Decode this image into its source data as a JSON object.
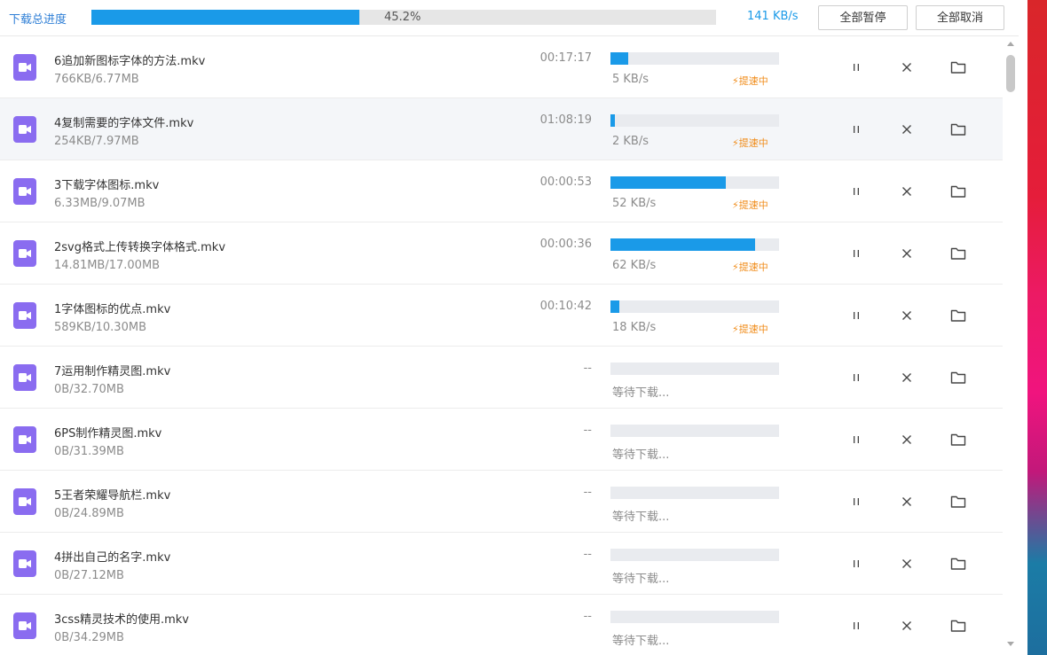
{
  "topbar": {
    "label": "下载总进度",
    "progress_percent": 45.2,
    "progress_text": "45.2%",
    "speed": "141 KB/s",
    "pause_all": "全部暂停",
    "cancel_all": "全部取消"
  },
  "colors": {
    "accent": "#1a9ae8",
    "boost": "#f08c1a",
    "file_icon": "#8a6cf0"
  },
  "icons": {
    "file": "video-file-icon",
    "pause": "pause-icon",
    "close": "close-icon",
    "folder": "folder-icon",
    "boost": "lightning-icon"
  },
  "downloads": [
    {
      "name": "6追加新图标字体的方法.mkv",
      "size": "766KB/6.77MB",
      "time": "00:17:17",
      "progress": 0.105,
      "speed": "5 KB/s",
      "boost": "提速中"
    },
    {
      "name": "4复制需要的字体文件.mkv",
      "size": "254KB/7.97MB",
      "time": "01:08:19",
      "progress": 0.025,
      "speed": "2 KB/s",
      "boost": "提速中"
    },
    {
      "name": "3下载字体图标.mkv",
      "size": "6.33MB/9.07MB",
      "time": "00:00:53",
      "progress": 0.685,
      "speed": "52 KB/s",
      "boost": "提速中"
    },
    {
      "name": "2svg格式上传转换字体格式.mkv",
      "size": "14.81MB/17.00MB",
      "time": "00:00:36",
      "progress": 0.86,
      "speed": "62 KB/s",
      "boost": "提速中"
    },
    {
      "name": "1字体图标的优点.mkv",
      "size": "589KB/10.30MB",
      "time": "00:10:42",
      "progress": 0.055,
      "speed": "18 KB/s",
      "boost": "提速中"
    },
    {
      "name": "7运用制作精灵图.mkv",
      "size": "0B/32.70MB",
      "time": "--",
      "progress": 0,
      "speed": "等待下载...",
      "boost": ""
    },
    {
      "name": "6PS制作精灵图.mkv",
      "size": "0B/31.39MB",
      "time": "--",
      "progress": 0,
      "speed": "等待下载...",
      "boost": ""
    },
    {
      "name": "5王者荣耀导航栏.mkv",
      "size": "0B/24.89MB",
      "time": "--",
      "progress": 0,
      "speed": "等待下载...",
      "boost": ""
    },
    {
      "name": "4拼出自己的名字.mkv",
      "size": "0B/27.12MB",
      "time": "--",
      "progress": 0,
      "speed": "等待下载...",
      "boost": ""
    },
    {
      "name": "3css精灵技术的使用.mkv",
      "size": "0B/34.29MB",
      "time": "--",
      "progress": 0,
      "speed": "等待下载...",
      "boost": ""
    }
  ]
}
